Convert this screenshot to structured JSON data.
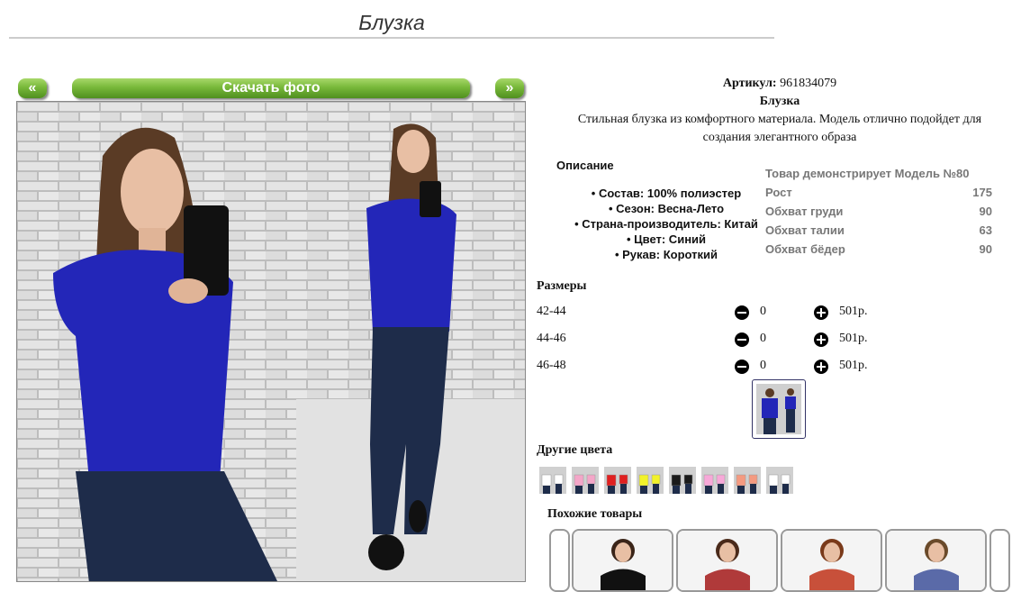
{
  "page": {
    "title": "Блузка"
  },
  "gallery": {
    "prev_label": "«",
    "next_label": "»",
    "download_label": "Скачать фото"
  },
  "product": {
    "article_label": "Артикул:",
    "article_value": "961834079",
    "name": "Блузка",
    "description_line1": "Стильная блузка из комфортного материала. Модель отлично подойдет для",
    "description_line2": "создания элегантного образа"
  },
  "details": {
    "title": "Описание",
    "items": [
      "Состав: 100% полиэстер",
      "Сезон: Весна-Лето",
      "Страна-производитель: Китай",
      "Цвет: Синий",
      "Рукав: Короткий"
    ]
  },
  "model": {
    "heading": "Товар демонстрирует Модель №80",
    "rows": [
      {
        "label": "Рост",
        "value": "175"
      },
      {
        "label": "Обхват груди",
        "value": "90"
      },
      {
        "label": "Обхват талии",
        "value": "63"
      },
      {
        "label": "Обхват бёдер",
        "value": "90"
      }
    ]
  },
  "sizes": {
    "title": "Размеры",
    "rows": [
      {
        "size": "42-44",
        "qty": "0",
        "price": "501р."
      },
      {
        "size": "44-46",
        "qty": "0",
        "price": "501р."
      },
      {
        "size": "46-48",
        "qty": "0",
        "price": "501р."
      }
    ]
  },
  "other_colors": {
    "title": "Другие цвета",
    "swatches": [
      "#ffffff",
      "#f4a6c8",
      "#e02020",
      "#f2f22a",
      "#1a1a1a",
      "#f7a8d8",
      "#f49a80",
      "#ffffff"
    ]
  },
  "similar": {
    "title": "Похожие товары"
  },
  "colors": {
    "accent_green": "#78b83a",
    "shirt_blue": "#2326b8"
  }
}
